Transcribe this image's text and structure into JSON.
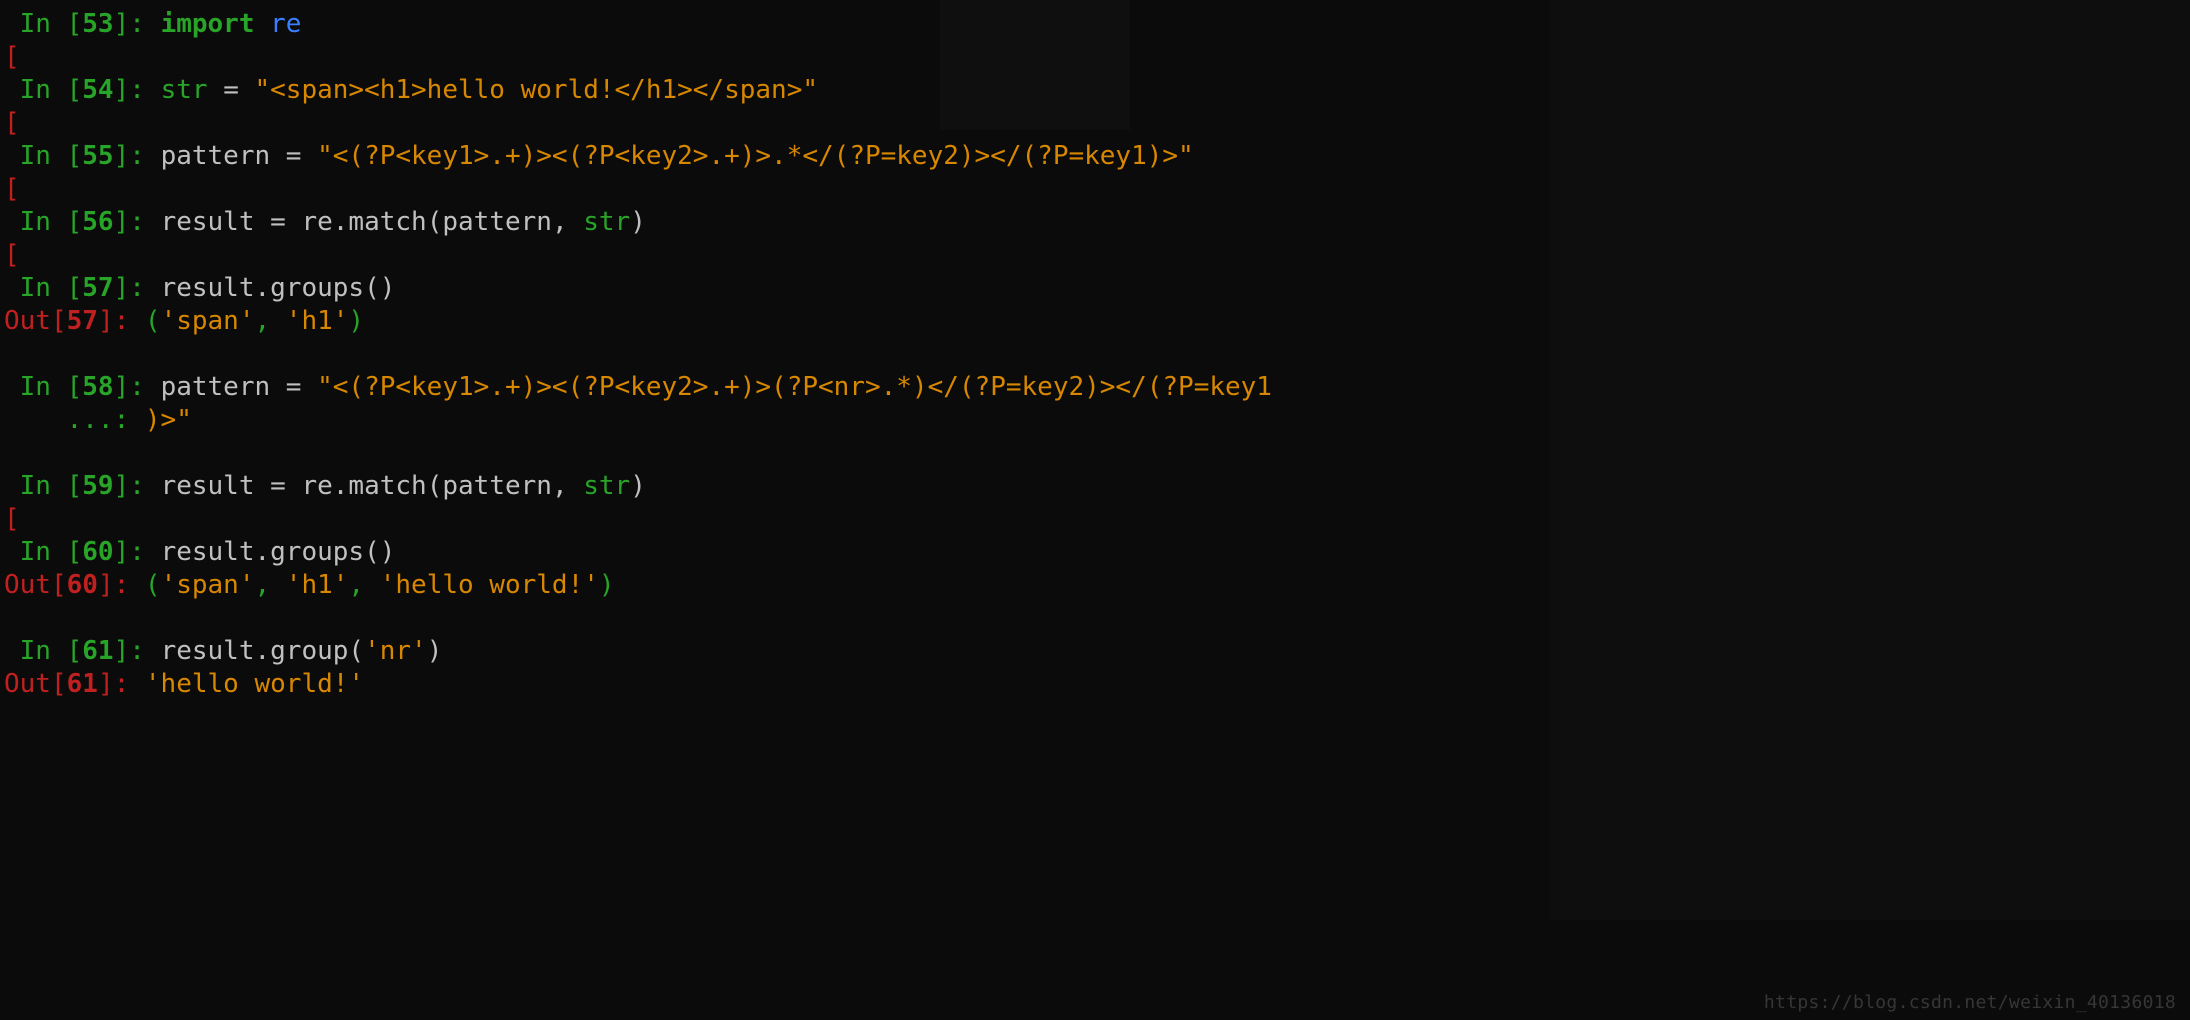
{
  "watermark": "https://blog.csdn.net/weixin_40136018",
  "cells": [
    {
      "kind": "in",
      "n": "53",
      "segments": [
        {
          "cls": "kw",
          "t": "import"
        },
        {
          "cls": "op",
          "t": " "
        },
        {
          "cls": "mod",
          "t": "re"
        }
      ]
    },
    {
      "kind": "bracket"
    },
    {
      "kind": "in",
      "n": "54",
      "segments": [
        {
          "cls": "builtin",
          "t": "str"
        },
        {
          "cls": "op",
          "t": " "
        },
        {
          "cls": "op",
          "t": "="
        },
        {
          "cls": "op",
          "t": " "
        },
        {
          "cls": "str",
          "t": "\"<span><h1>hello world!</h1></span>\""
        }
      ]
    },
    {
      "kind": "bracket"
    },
    {
      "kind": "in",
      "n": "55",
      "segments": [
        {
          "cls": "name",
          "t": "pattern "
        },
        {
          "cls": "op",
          "t": "="
        },
        {
          "cls": "op",
          "t": " "
        },
        {
          "cls": "str",
          "t": "\"<(?P<key1>.+)><(?P<key2>.+)>.*</(?P=key2)></(?P=key1)>\""
        }
      ]
    },
    {
      "kind": "bracket"
    },
    {
      "kind": "in",
      "n": "56",
      "segments": [
        {
          "cls": "name",
          "t": "result "
        },
        {
          "cls": "op",
          "t": "="
        },
        {
          "cls": "name",
          "t": " re"
        },
        {
          "cls": "op",
          "t": "."
        },
        {
          "cls": "name",
          "t": "match"
        },
        {
          "cls": "op",
          "t": "("
        },
        {
          "cls": "name",
          "t": "pattern"
        },
        {
          "cls": "op",
          "t": ", "
        },
        {
          "cls": "builtin",
          "t": "str"
        },
        {
          "cls": "op",
          "t": ")"
        }
      ]
    },
    {
      "kind": "bracket"
    },
    {
      "kind": "in",
      "n": "57",
      "segments": [
        {
          "cls": "name",
          "t": "result"
        },
        {
          "cls": "op",
          "t": "."
        },
        {
          "cls": "name",
          "t": "groups"
        },
        {
          "cls": "op",
          "t": "()"
        }
      ]
    },
    {
      "kind": "out",
      "n": "57",
      "segments": [
        {
          "cls": "out-par",
          "t": "("
        },
        {
          "cls": "out-val",
          "t": "'span'"
        },
        {
          "cls": "out-par",
          "t": ", "
        },
        {
          "cls": "out-val",
          "t": "'h1'"
        },
        {
          "cls": "out-par",
          "t": ")"
        }
      ]
    },
    {
      "kind": "blank"
    },
    {
      "kind": "in",
      "n": "58",
      "segments": [
        {
          "cls": "name",
          "t": "pattern "
        },
        {
          "cls": "op",
          "t": "="
        },
        {
          "cls": "op",
          "t": " "
        },
        {
          "cls": "str",
          "t": "\"<(?P<key1>.+)><(?P<key2>.+)>(?P<nr>.*)</(?P=key2)></(?P=key1"
        }
      ]
    },
    {
      "kind": "cont",
      "segments": [
        {
          "cls": "str",
          "t": ")>\""
        }
      ],
      "cont_label": "...: "
    },
    {
      "kind": "blank"
    },
    {
      "kind": "in",
      "n": "59",
      "segments": [
        {
          "cls": "name",
          "t": "result "
        },
        {
          "cls": "op",
          "t": "="
        },
        {
          "cls": "name",
          "t": " re"
        },
        {
          "cls": "op",
          "t": "."
        },
        {
          "cls": "name",
          "t": "match"
        },
        {
          "cls": "op",
          "t": "("
        },
        {
          "cls": "name",
          "t": "pattern"
        },
        {
          "cls": "op",
          "t": ", "
        },
        {
          "cls": "builtin",
          "t": "str"
        },
        {
          "cls": "op",
          "t": ")"
        }
      ]
    },
    {
      "kind": "bracket"
    },
    {
      "kind": "in",
      "n": "60",
      "segments": [
        {
          "cls": "name",
          "t": "result"
        },
        {
          "cls": "op",
          "t": "."
        },
        {
          "cls": "name",
          "t": "groups"
        },
        {
          "cls": "op",
          "t": "()"
        }
      ]
    },
    {
      "kind": "out",
      "n": "60",
      "segments": [
        {
          "cls": "out-par",
          "t": "("
        },
        {
          "cls": "out-val",
          "t": "'span'"
        },
        {
          "cls": "out-par",
          "t": ", "
        },
        {
          "cls": "out-val",
          "t": "'h1'"
        },
        {
          "cls": "out-par",
          "t": ", "
        },
        {
          "cls": "out-val",
          "t": "'hello world!'"
        },
        {
          "cls": "out-par",
          "t": ")"
        }
      ]
    },
    {
      "kind": "blank"
    },
    {
      "kind": "in",
      "n": "61",
      "segments": [
        {
          "cls": "name",
          "t": "result"
        },
        {
          "cls": "op",
          "t": "."
        },
        {
          "cls": "name",
          "t": "group"
        },
        {
          "cls": "op",
          "t": "("
        },
        {
          "cls": "str",
          "t": "'nr'"
        },
        {
          "cls": "op",
          "t": ")"
        }
      ]
    },
    {
      "kind": "out",
      "n": "61",
      "segments": [
        {
          "cls": "out-val",
          "t": "'hello world!'"
        }
      ]
    }
  ],
  "prompt_labels": {
    "in_prefix": "In [",
    "in_suffix": "]: ",
    "out_prefix": "Out[",
    "out_suffix": "]: ",
    "bracket_only": "["
  }
}
